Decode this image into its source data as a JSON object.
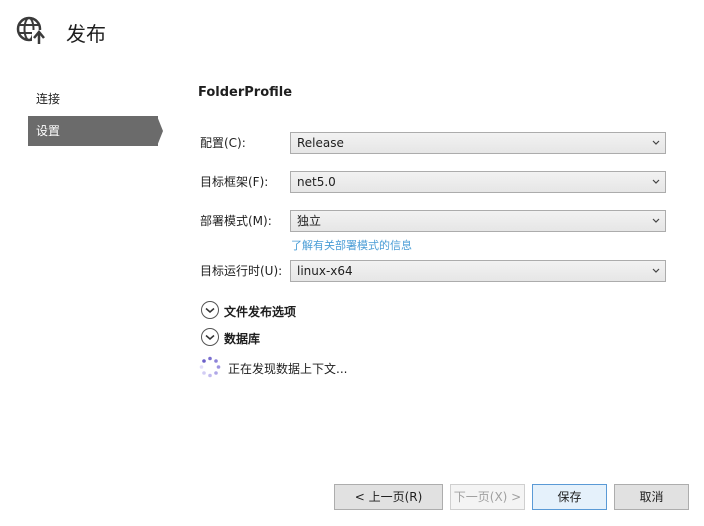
{
  "header": {
    "title": "发布",
    "icon": "globe-publish-icon"
  },
  "sidebar": {
    "items": [
      {
        "label": "连接",
        "active": false
      },
      {
        "label": "设置",
        "active": true
      }
    ]
  },
  "profile_name": "FolderProfile",
  "fields": {
    "configuration": {
      "label": "配置(C):",
      "value": "Release"
    },
    "target_framework": {
      "label": "目标框架(F):",
      "value": "net5.0"
    },
    "deployment_mode": {
      "label": "部署模式(M):",
      "value": "独立"
    },
    "deployment_link": "了解有关部署模式的信息",
    "target_runtime": {
      "label": "目标运行时(U):",
      "value": "linux-x64"
    }
  },
  "sections": {
    "file_publish_options": "文件发布选项",
    "databases": "数据库"
  },
  "status": {
    "discovering": "正在发现数据上下文..."
  },
  "buttons": {
    "previous": "< 上一页(R)",
    "next": "下一页(X) >",
    "save": "保存",
    "cancel": "取消"
  },
  "colors": {
    "sidebar_active": "#6b6b6b",
    "link": "#4a9dd6",
    "primary_border": "#5a9ad6"
  }
}
